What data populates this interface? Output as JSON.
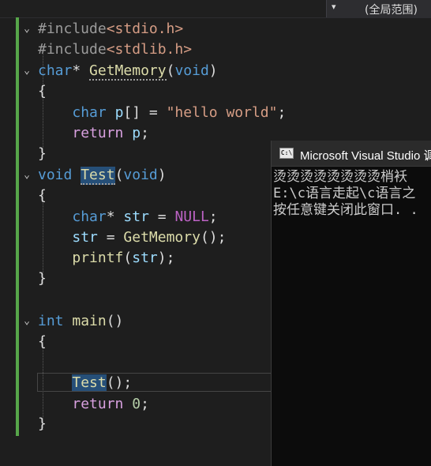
{
  "toolbar": {
    "scope_label": "(全局范围)",
    "scope_arrow": "▾"
  },
  "code": {
    "l1": {
      "directive": "#include",
      "header": "<stdio.h>"
    },
    "l2": {
      "directive": "#include",
      "header": "<stdlib.h>"
    },
    "l3": {
      "type": "char",
      "ptr": "*",
      "name": "GetMemory",
      "open": "(",
      "param": "void",
      "close": ")"
    },
    "l4": {
      "brace": "{"
    },
    "l5": {
      "type": "char",
      "var": "p",
      "rest": "[] = ",
      "str": "\"hello world\"",
      "end": ";"
    },
    "l6": {
      "kw": "return",
      "var": "p",
      "end": ";"
    },
    "l7": {
      "brace": "}"
    },
    "l8": {
      "type": "void",
      "name": "Test",
      "open": "(",
      "param": "void",
      "close": ")"
    },
    "l9": {
      "brace": "{"
    },
    "l10": {
      "type": "char",
      "ptr": "*",
      "var": "str",
      "eq": " = ",
      "macro": "NULL",
      "end": ";"
    },
    "l11": {
      "var": "str",
      "eq": " = ",
      "fn": "GetMemory",
      "rest": "();"
    },
    "l12": {
      "fn": "printf",
      "open": "(",
      "var": "str",
      "rest": ");"
    },
    "l13": {
      "brace": "}"
    },
    "l14": {
      "type": "int",
      "name": "main",
      "rest": "()"
    },
    "l15": {
      "brace": "{"
    },
    "l16": {
      "fn": "Test",
      "rest": "();"
    },
    "l17": {
      "kw": "return",
      "num": "0",
      "end": ";"
    },
    "l18": {
      "brace": "}"
    }
  },
  "fold_icons": {
    "expanded": "⌄"
  },
  "console": {
    "title": "Microsoft Visual Studio 调",
    "icon_text": "C:\\",
    "lines": [
      "烫烫烫烫烫烫烫烫梢袄",
      "E:\\c语言走起\\c语言之",
      "按任意键关闭此窗口. ."
    ]
  }
}
